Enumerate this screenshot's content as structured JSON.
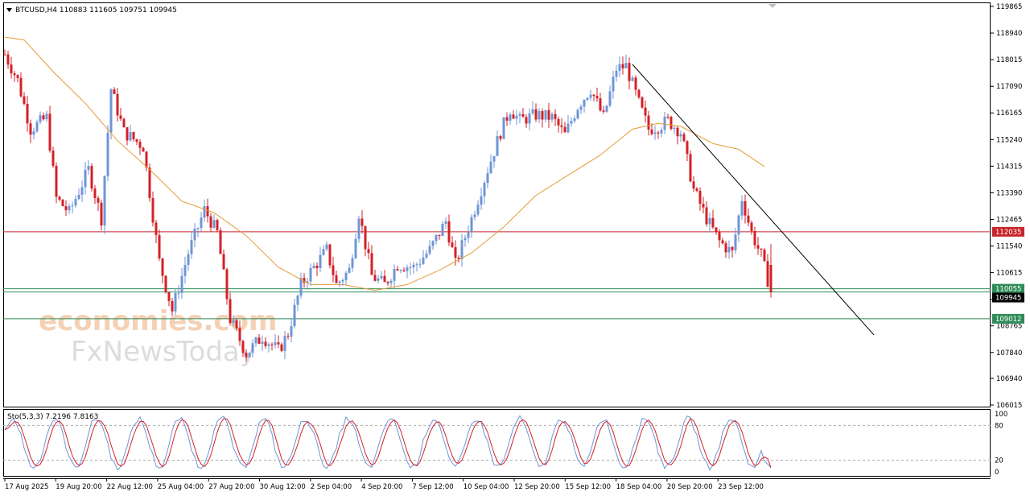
{
  "header": {
    "symbol_line": "BTCUSD,H4  110883 111605 109751 109945",
    "indicator_line": "Sto(5,3,3) 7.2196 7.8163"
  },
  "watermark": {
    "line1": "economies.com",
    "line2": "FxNewsToday"
  },
  "colors": {
    "background": "#ffffff",
    "bull": "#6f95d6",
    "bear": "#d32027",
    "ma": "#e49b36",
    "trendline": "#000000",
    "resistance": "#c8242a",
    "support": "#2e8b57",
    "stoch_main": "#6f95d6",
    "stoch_signal": "#d32027",
    "grid_dash": "#aaaaaa"
  },
  "price_axis": {
    "ticks": [
      "119865",
      "118940",
      "118015",
      "117090",
      "116165",
      "115240",
      "114315",
      "113390",
      "112465",
      "111540",
      "110615",
      "109690",
      "108765",
      "107840",
      "106940",
      "106015"
    ],
    "range": [
      106015,
      119865
    ]
  },
  "stoch_axis": {
    "ticks": [
      "100",
      "80",
      "20",
      "0"
    ],
    "levels": [
      80,
      20
    ]
  },
  "time_axis": {
    "labels": [
      "17 Aug 2025",
      "19 Aug 20:00",
      "22 Aug 12:00",
      "25 Aug 04:00",
      "27 Aug 20:00",
      "30 Aug 12:00",
      "2 Sep 04:00",
      "4 Sep 20:00",
      "7 Sep 12:00",
      "10 Sep 04:00",
      "12 Sep 20:00",
      "15 Sep 12:00",
      "18 Sep 04:00",
      "20 Sep 20:00",
      "23 Sep 12:00"
    ]
  },
  "price_levels": [
    {
      "name": "resistance",
      "label": "112035",
      "value": 112035
    },
    {
      "name": "support-upper",
      "label": "110055",
      "value": 110055
    },
    {
      "name": "support-lower",
      "label": "109012",
      "value": 109012
    }
  ],
  "current_price": {
    "label": "109945",
    "value": 109945
  },
  "chart_data": {
    "type": "candlestick",
    "symbol": "BTCUSD",
    "timeframe": "H4",
    "ohlc_last": {
      "open": 110883,
      "high": 111605,
      "low": 109751,
      "close": 109945
    },
    "y_range": [
      106015,
      119865
    ],
    "close_path": [
      {
        "t": 0,
        "p": 118200
      },
      {
        "t": 4,
        "p": 117300
      },
      {
        "t": 8,
        "p": 115600
      },
      {
        "t": 13,
        "p": 116000
      },
      {
        "t": 16,
        "p": 113200
      },
      {
        "t": 20,
        "p": 112700
      },
      {
        "t": 26,
        "p": 114200
      },
      {
        "t": 30,
        "p": 112500
      },
      {
        "t": 33,
        "p": 117000
      },
      {
        "t": 37,
        "p": 115500
      },
      {
        "t": 43,
        "p": 115000
      },
      {
        "t": 48,
        "p": 111000
      },
      {
        "t": 52,
        "p": 109300
      },
      {
        "t": 57,
        "p": 111300
      },
      {
        "t": 62,
        "p": 112800
      },
      {
        "t": 66,
        "p": 112000
      },
      {
        "t": 70,
        "p": 109000
      },
      {
        "t": 75,
        "p": 107800
      },
      {
        "t": 80,
        "p": 108400
      },
      {
        "t": 85,
        "p": 107900
      },
      {
        "t": 88,
        "p": 108500
      },
      {
        "t": 92,
        "p": 110200
      },
      {
        "t": 96,
        "p": 110800
      },
      {
        "t": 100,
        "p": 111400
      },
      {
        "t": 103,
        "p": 110200
      },
      {
        "t": 107,
        "p": 110700
      },
      {
        "t": 110,
        "p": 112700
      },
      {
        "t": 114,
        "p": 110500
      },
      {
        "t": 118,
        "p": 110200
      },
      {
        "t": 122,
        "p": 110900
      },
      {
        "t": 127,
        "p": 110800
      },
      {
        "t": 132,
        "p": 111400
      },
      {
        "t": 137,
        "p": 112400
      },
      {
        "t": 140,
        "p": 110900
      },
      {
        "t": 145,
        "p": 112500
      },
      {
        "t": 150,
        "p": 114200
      },
      {
        "t": 154,
        "p": 115500
      },
      {
        "t": 157,
        "p": 116300
      },
      {
        "t": 160,
        "p": 115900
      },
      {
        "t": 165,
        "p": 116100
      },
      {
        "t": 170,
        "p": 116000
      },
      {
        "t": 174,
        "p": 115400
      },
      {
        "t": 178,
        "p": 116400
      },
      {
        "t": 182,
        "p": 117000
      },
      {
        "t": 186,
        "p": 116000
      },
      {
        "t": 190,
        "p": 117700
      },
      {
        "t": 193,
        "p": 117800
      },
      {
        "t": 197,
        "p": 116500
      },
      {
        "t": 200,
        "p": 115600
      },
      {
        "t": 203,
        "p": 115700
      },
      {
        "t": 206,
        "p": 115900
      },
      {
        "t": 210,
        "p": 115500
      },
      {
        "t": 214,
        "p": 113500
      },
      {
        "t": 218,
        "p": 112500
      },
      {
        "t": 222,
        "p": 111700
      },
      {
        "t": 226,
        "p": 111300
      },
      {
        "t": 229,
        "p": 113200
      },
      {
        "t": 232,
        "p": 112000
      },
      {
        "t": 235,
        "p": 111200
      },
      {
        "t": 238,
        "p": 109945
      }
    ],
    "moving_average": [
      {
        "t": 0,
        "p": 118800
      },
      {
        "t": 6,
        "p": 118700
      },
      {
        "t": 15,
        "p": 117600
      },
      {
        "t": 25,
        "p": 116500
      },
      {
        "t": 35,
        "p": 115200
      },
      {
        "t": 45,
        "p": 114200
      },
      {
        "t": 55,
        "p": 113100
      },
      {
        "t": 65,
        "p": 112700
      },
      {
        "t": 75,
        "p": 111900
      },
      {
        "t": 85,
        "p": 110800
      },
      {
        "t": 95,
        "p": 110200
      },
      {
        "t": 105,
        "p": 110200
      },
      {
        "t": 115,
        "p": 110000
      },
      {
        "t": 125,
        "p": 110200
      },
      {
        "t": 135,
        "p": 110700
      },
      {
        "t": 145,
        "p": 111300
      },
      {
        "t": 155,
        "p": 112200
      },
      {
        "t": 165,
        "p": 113300
      },
      {
        "t": 175,
        "p": 114000
      },
      {
        "t": 185,
        "p": 114700
      },
      {
        "t": 195,
        "p": 115600
      },
      {
        "t": 203,
        "p": 115800
      },
      {
        "t": 210,
        "p": 115700
      },
      {
        "t": 220,
        "p": 115100
      },
      {
        "t": 228,
        "p": 114900
      },
      {
        "t": 236,
        "p": 114300
      }
    ],
    "trendline": [
      {
        "t": 195,
        "p": 117850
      },
      {
        "t": 270,
        "p": 108450
      }
    ],
    "stochastic": {
      "params": "5,3,3",
      "main": 7.2196,
      "signal": 7.8163,
      "levels": [
        80,
        20
      ]
    }
  }
}
